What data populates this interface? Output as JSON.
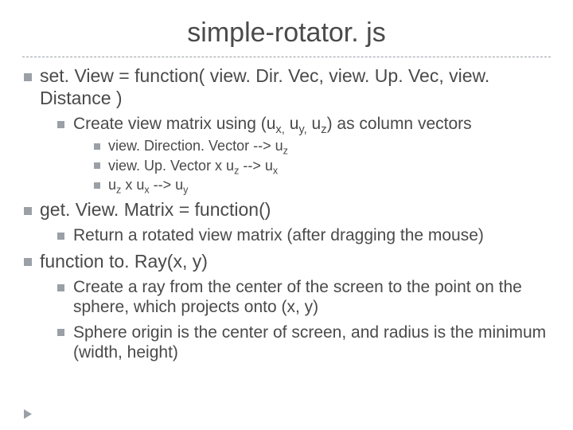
{
  "title": "simple-rotator. js",
  "items": [
    {
      "text_html": "set. View = function( view. Dir. Vec, view. Up. Vec, view. Distance )",
      "children": [
        {
          "text_html": "Create view matrix using (u<sub>x,</sub> u<sub>y,</sub> u<sub>z</sub>) as column vectors",
          "children": [
            {
              "text_html": "view. Direction. Vector --&gt; u<sub>z</sub>"
            },
            {
              "text_html": "view. Up. Vector x u<sub>z</sub> --&gt; u<sub>x</sub>"
            },
            {
              "text_html": "u<sub>z</sub> x u<sub>x</sub> --&gt; u<sub>y</sub>"
            }
          ]
        }
      ]
    },
    {
      "text_html": "get. View. Matrix = function()",
      "children": [
        {
          "text_html": "Return a rotated view matrix (after dragging the mouse)"
        }
      ]
    },
    {
      "text_html": "function to. Ray(x, y)",
      "children": [
        {
          "text_html": "Create a ray from the center of the screen to the point on the sphere, which projects onto (x, y)"
        },
        {
          "text_html": "Sphere origin is the center of screen, and radius is the minimum (width, height)"
        }
      ]
    }
  ]
}
